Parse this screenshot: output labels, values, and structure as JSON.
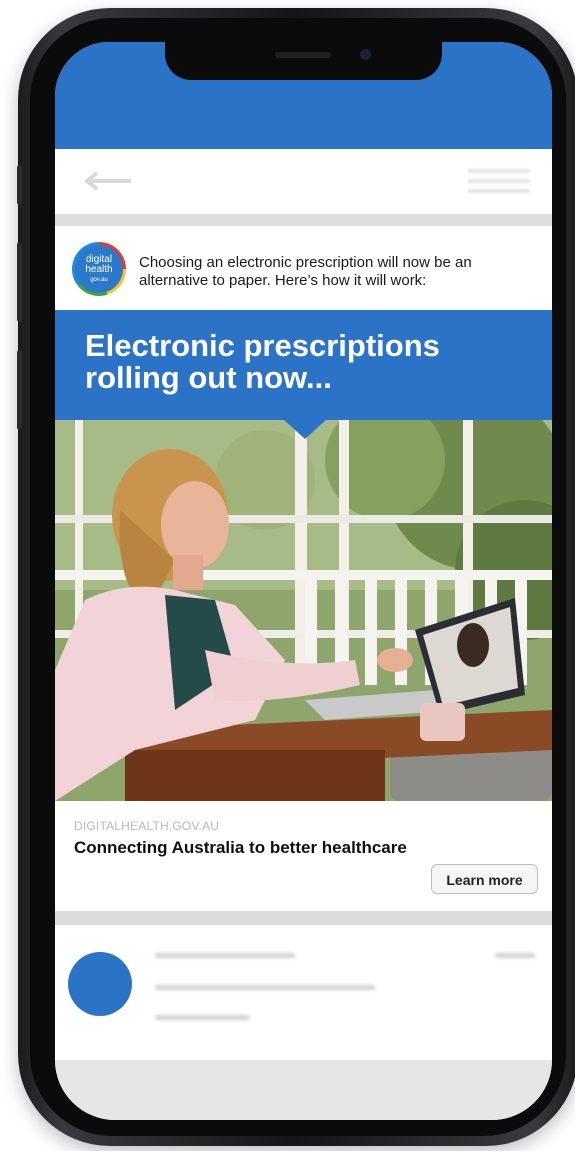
{
  "post": {
    "text": "Choosing an electronic prescription will now be an alternative to paper. Here’s how it will work:",
    "logo_lines": [
      "digital",
      "health",
      "gov.au"
    ]
  },
  "ad": {
    "banner_title": "Electronic prescriptions rolling out now...",
    "domain": "DIGITALHEALTH.GOV.AU",
    "headline": "Connecting Australia to better healthcare",
    "cta_label": "Learn more"
  },
  "icons": {
    "back": "back-arrow-icon",
    "menu": "menu-icon"
  },
  "colors": {
    "brand_blue": "#2b73c6",
    "cta_border": "#bdbdbd"
  }
}
